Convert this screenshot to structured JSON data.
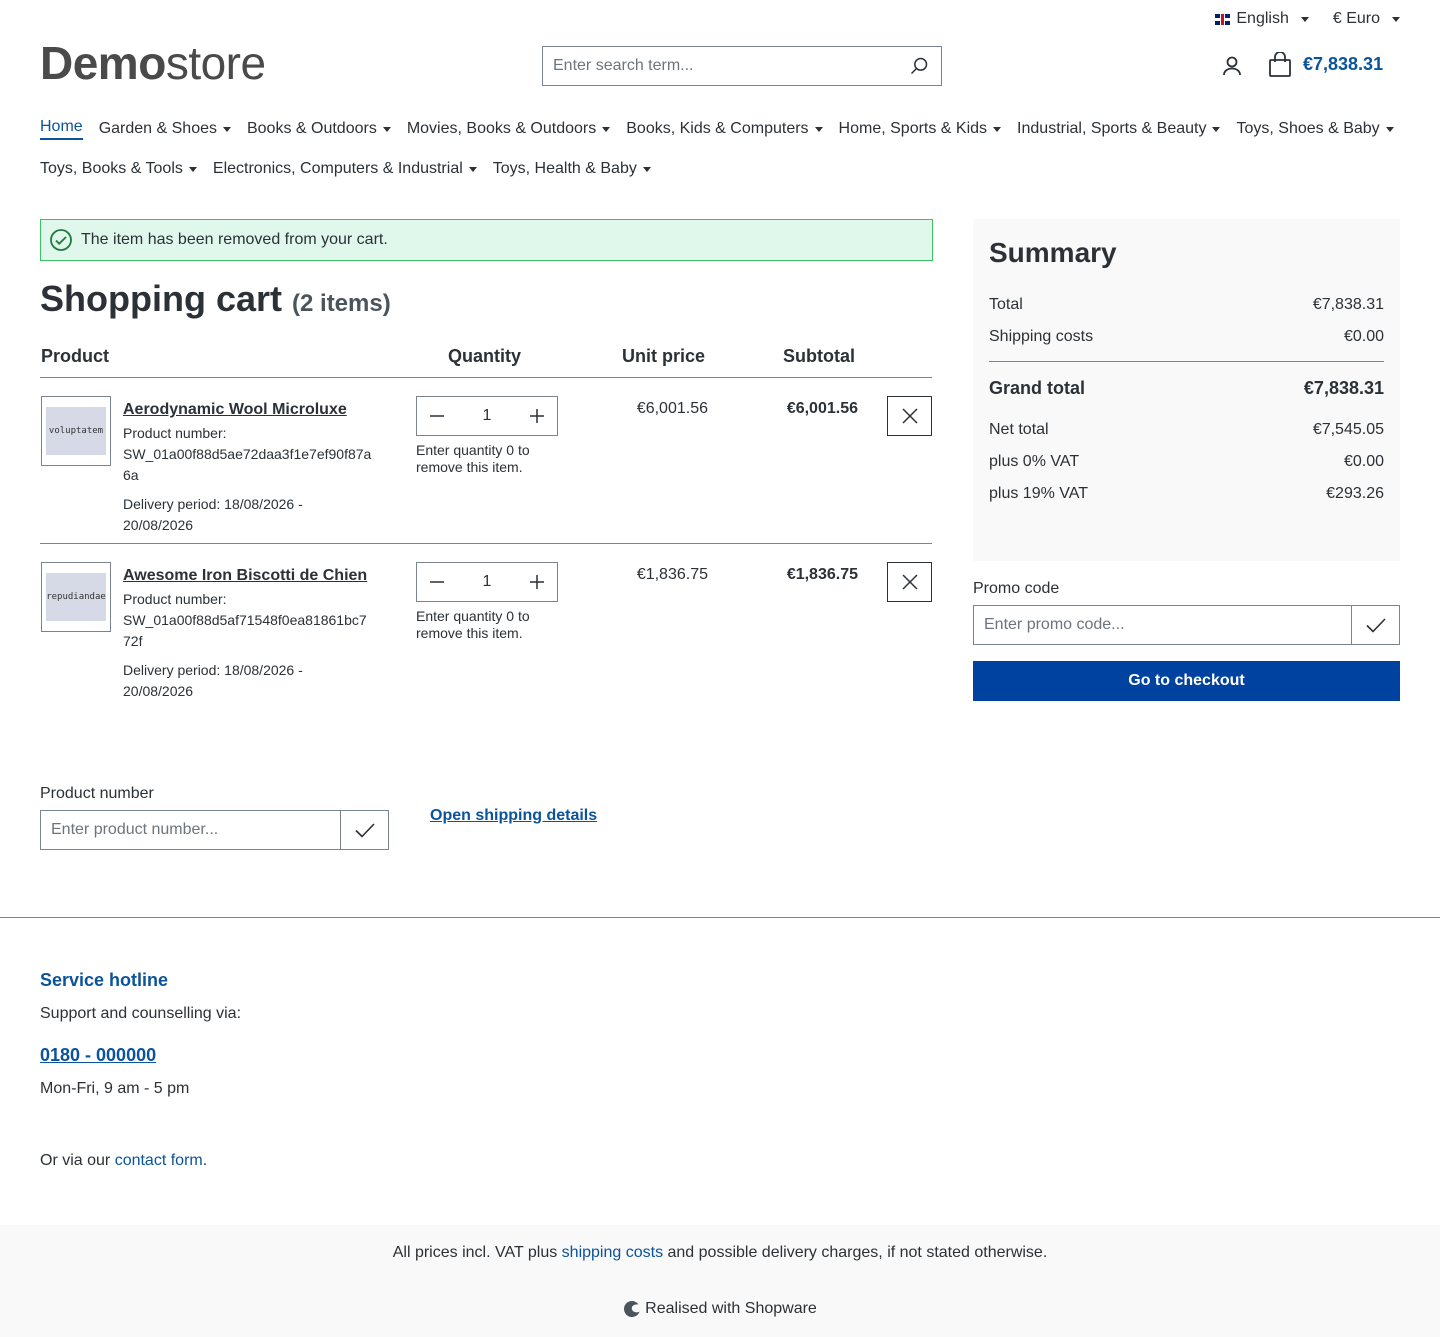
{
  "topbar": {
    "language": "English",
    "currency": "€ Euro"
  },
  "header": {
    "logo_bold": "Demo",
    "logo_light": "store",
    "search_placeholder": "Enter search term...",
    "cart_total": "€7,838.31"
  },
  "nav": {
    "items": [
      {
        "label": "Home",
        "active": true,
        "dropdown": false
      },
      {
        "label": "Garden & Shoes",
        "dropdown": true
      },
      {
        "label": "Books & Outdoors",
        "dropdown": true
      },
      {
        "label": "Movies, Books & Outdoors",
        "dropdown": true
      },
      {
        "label": "Books, Kids & Computers",
        "dropdown": true
      },
      {
        "label": "Home, Sports & Kids",
        "dropdown": true
      },
      {
        "label": "Industrial, Sports & Beauty",
        "dropdown": true
      },
      {
        "label": "Toys, Shoes & Baby",
        "dropdown": true
      },
      {
        "label": "Toys, Books & Tools",
        "dropdown": true
      },
      {
        "label": "Electronics, Computers & Industrial",
        "dropdown": true
      },
      {
        "label": "Toys, Health & Baby",
        "dropdown": true
      }
    ]
  },
  "alert": {
    "message": "The item has been removed from your cart."
  },
  "cart": {
    "title": "Shopping cart",
    "count": "(2 items)",
    "headers": {
      "product": "Product",
      "quantity": "Quantity",
      "unit_price": "Unit price",
      "subtotal": "Subtotal"
    },
    "items": [
      {
        "name": "Aerodynamic Wool Microluxe",
        "thumb_text": "voluptatem",
        "number_label": "Product number:",
        "number": "SW_01a00f88d5ae72daa3f1e7ef90f87a6a",
        "delivery": "Delivery period: 18/08/2026 - 20/08/2026",
        "quantity": "1",
        "qty_hint": "Enter quantity 0 to remove this item.",
        "unit_price": "€6,001.56",
        "subtotal": "€6,001.56"
      },
      {
        "name": "Awesome Iron Biscotti de Chien",
        "thumb_text": "repudiandae",
        "number_label": "Product number:",
        "number": "SW_01a00f88d5af71548f0ea81861bc772f",
        "delivery": "Delivery period: 18/08/2026 - 20/08/2026",
        "quantity": "1",
        "qty_hint": "Enter quantity 0 to remove this item.",
        "unit_price": "€1,836.75",
        "subtotal": "€1,836.75"
      }
    ],
    "product_number_label": "Product number",
    "product_number_placeholder": "Enter product number...",
    "shipping_link": "Open shipping details"
  },
  "summary": {
    "title": "Summary",
    "total_label": "Total",
    "total": "€7,838.31",
    "shipping_label": "Shipping costs",
    "shipping": "€0.00",
    "grand_label": "Grand total",
    "grand": "€7,838.31",
    "net_label": "Net total",
    "net": "€7,545.05",
    "vat0_label": "plus 0% VAT",
    "vat0": "€0.00",
    "vat19_label": "plus 19% VAT",
    "vat19": "€293.26",
    "promo_label": "Promo code",
    "promo_placeholder": "Enter promo code...",
    "checkout": "Go to checkout"
  },
  "footer": {
    "hotline_title": "Service hotline",
    "hotline_sub": "Support and counselling via:",
    "phone": "0180 - 000000",
    "hours": "Mon-Fri, 9 am - 5 pm",
    "contact_prefix": "Or via our ",
    "contact_link": "contact form",
    "contact_suffix": ".",
    "vat_prefix": "All prices incl. VAT plus ",
    "vat_link": "shipping costs",
    "vat_suffix": " and possible delivery charges, if not stated otherwise.",
    "realised": "Realised with Shopware"
  },
  "colors": {
    "primary": "#0b539b",
    "checkout": "#0042a0",
    "success_bg": "#e0f7ec",
    "success_border": "#3cc261"
  }
}
